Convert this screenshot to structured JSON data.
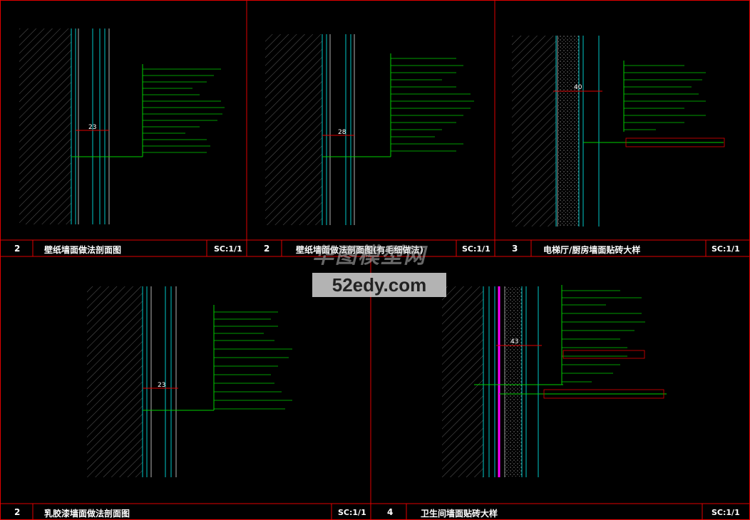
{
  "colors": {
    "frame": "#e00000",
    "annotation": "#00d000",
    "hatch": "#5a5a5a",
    "wall_line": "#00c8c8",
    "dimension": "#00ff00",
    "highlight": "#ff00ff",
    "text": "#ffffff"
  },
  "panels": [
    {
      "number": "2",
      "title": "壁纸墙面做法剖面图",
      "scale": "SC:1/1",
      "dimension": "23",
      "notes": [
        "壁纸墙面(详见墙面做法)",
        "…",
        "…"
      ]
    },
    {
      "number": "2",
      "title": "壁纸墙面做法剖面图(有毛细做法)",
      "scale": "SC:1/1",
      "dimension": "28",
      "notes": [
        "…"
      ]
    },
    {
      "number": "3",
      "title": "电梯厅/厨房墙面贴砖大样",
      "scale": "SC:1/1",
      "dimension": "40",
      "notes": [
        "…"
      ]
    },
    {
      "number": "2",
      "title": "乳胶漆墙面做法剖面图",
      "scale": "SC:1/1",
      "dimension": "23",
      "notes": [
        "…"
      ]
    },
    {
      "number": "4",
      "title": "卫生间墙面贴砖大样",
      "scale": "SC:1/1",
      "dimension": "43",
      "notes": [
        "…"
      ]
    }
  ],
  "watermark": {
    "brand": "华图模型网",
    "url": "52edy.com"
  }
}
